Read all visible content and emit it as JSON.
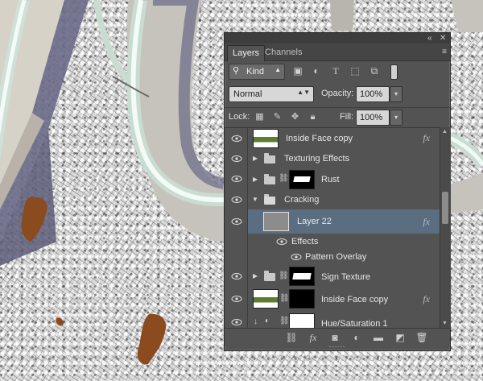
{
  "panel": {
    "collapse_icon": "double-chevron-left-icon",
    "close_icon": "close-icon",
    "tabs": [
      {
        "label": "Layers",
        "active": true
      },
      {
        "label": "Channels",
        "active": false
      }
    ],
    "panel_menu_icon": "panel-menu-icon"
  },
  "filter": {
    "kind_label": "Kind",
    "icons": [
      "pixel-filter-icon",
      "adjustment-filter-icon",
      "type-filter-icon",
      "shape-filter-icon",
      "smart-object-filter-icon"
    ]
  },
  "blend": {
    "mode": "Normal",
    "opacity_label": "Opacity:",
    "opacity_value": "100%",
    "lock_label": "Lock:",
    "fill_label": "Fill:",
    "fill_value": "100%"
  },
  "layers": [
    {
      "name": "Inside Face copy",
      "type": "layer",
      "has_fx": true,
      "thumb": "green"
    },
    {
      "name": "Texturing Effects",
      "type": "group",
      "expanded": false
    },
    {
      "name": "Rust",
      "type": "group-mask",
      "expanded": false
    },
    {
      "name": "Cracking",
      "type": "group",
      "expanded": true
    },
    {
      "name": "Layer 22",
      "type": "layer",
      "selected": true,
      "has_fx": true
    },
    {
      "name": "Effects",
      "type": "effects-header"
    },
    {
      "name": "Pattern Overlay",
      "type": "effect"
    },
    {
      "name": "Sign Texture",
      "type": "group-mask",
      "expanded": false
    },
    {
      "name": "Inside Face copy",
      "type": "layer-mask",
      "has_fx": true
    },
    {
      "name": "Hue/Saturation 1",
      "type": "adjustment"
    }
  ],
  "fx_label": "fx",
  "bottom_icons": [
    "link-layers-icon",
    "fx-icon",
    "add-mask-icon",
    "adjustment-layer-icon",
    "new-group-icon",
    "new-layer-icon",
    "trash-icon"
  ],
  "colors": {
    "panel_bg": "#535353",
    "selected_row": "#5b6d80",
    "rust": "#8a4b1f"
  }
}
